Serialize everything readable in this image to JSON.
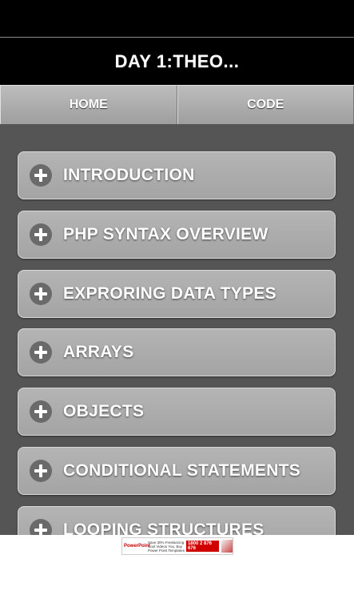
{
  "header": {
    "title": "DAY 1:THEO..."
  },
  "nav": {
    "home_label": "HOME",
    "code_label": "CODE"
  },
  "topics": [
    {
      "label": "INTRODUCTION",
      "icon": "plus-circle-icon"
    },
    {
      "label": "PHP SYNTAX OVERVIEW",
      "icon": "plus-circle-icon"
    },
    {
      "label": "EXPRORING DATA TYPES",
      "icon": "plus-circle-icon"
    },
    {
      "label": "ARRAYS",
      "icon": "plus-circle-icon"
    },
    {
      "label": "OBJECTS",
      "icon": "plus-circle-icon"
    },
    {
      "label": "CONDITIONAL STATEMENTS",
      "icon": "plus-circle-icon"
    },
    {
      "label": "LOOPING STRUCTURES",
      "icon": "plus-circle-icon"
    }
  ],
  "ad": {
    "brand": "PowerPoint",
    "text": "Save 30% Freelancing Cool Videos You. Buy Power Point Templates",
    "phone": "1800 2 876 676"
  },
  "colors": {
    "status_bar": "#000000",
    "header_bg": "#000000",
    "content_bg": "#555555",
    "item_bg": "#ababab",
    "icon_bg": "#6a6a6a"
  }
}
